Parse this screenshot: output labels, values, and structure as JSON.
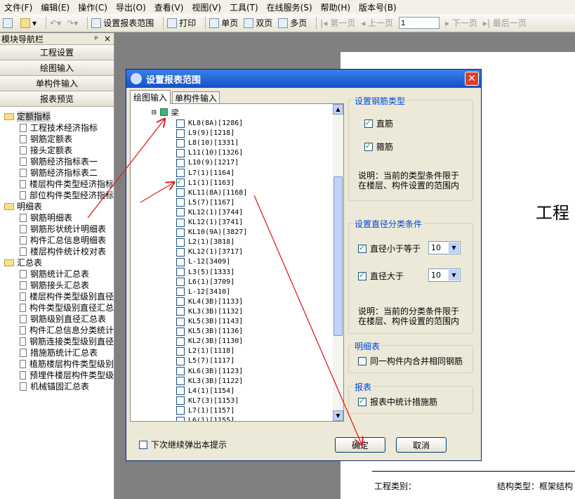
{
  "menu": [
    "文件(F)",
    "编辑(E)",
    "操作(C)",
    "导出(O)",
    "查看(V)",
    "视图(V)",
    "工具(T)",
    "在线服务(S)",
    "帮助(H)",
    "版本号(B)"
  ],
  "toolbar": {
    "set_range": "设置报表范围",
    "print": "打印",
    "single": "单页",
    "double": "双页",
    "multi": "多页",
    "first": "第一页",
    "prev": "上一页",
    "page_value": "1",
    "next": "下一页",
    "last": "最后一页"
  },
  "panel": {
    "title": "模块导航栏",
    "pin": "ᵖ",
    "close": "×",
    "nav": [
      "工程设置",
      "绘图输入",
      "单构件输入",
      "报表预览"
    ],
    "tree": [
      {
        "type": "folder",
        "label": "定额指标",
        "children": [
          "工程技术经济指标",
          "钢筋定额表",
          "接头定额表",
          "钢筋经济指标表一",
          "钢筋经济指标表二",
          "楼层构件类型经济指标",
          "部位构件类型经济指标"
        ]
      },
      {
        "type": "folder",
        "label": "明细表",
        "children": [
          "钢筋明细表",
          "钢筋形状统计明细表",
          "构件汇总信息明细表",
          "楼层构件统计校对表"
        ]
      },
      {
        "type": "folder",
        "label": "汇总表",
        "children": [
          "钢筋统计汇总表",
          "钢筋接头汇总表",
          "楼层构件类型级别直径",
          "构件类型级别直径汇总",
          "钢筋级别直径汇总表",
          "构件汇总信息分类统计",
          "钢筋连接类型级别直径",
          "措施筋统计汇总表",
          "植筋楼层构件类型级别",
          "预埋件楼层构件类型级",
          "机械锚固汇总表"
        ]
      }
    ]
  },
  "preview": {
    "title": "工程",
    "footer_left": "工程类别：",
    "footer_right": "结构类型：框架结构"
  },
  "dialog": {
    "title": "设置报表范围",
    "close": "✕",
    "tabs": [
      "绘图输入",
      "单构件输入"
    ],
    "tree_root": "梁",
    "expander": "⊟",
    "items": [
      {
        "label": "KL8(8A)[1286]",
        "checked": false
      },
      {
        "label": "L9(9)[1218]",
        "checked": false
      },
      {
        "label": "L8(10)[1331]",
        "checked": false
      },
      {
        "label": "L11(10)[1326]",
        "checked": false
      },
      {
        "label": "L10(9)[1217]",
        "checked": false
      },
      {
        "label": "L7(1)[1164]",
        "checked": false
      },
      {
        "label": "L1(1)[1163]",
        "checked": true
      },
      {
        "label": "KL11(8A)[1168]",
        "checked": false
      },
      {
        "label": "L5(7)[1167]",
        "checked": false
      },
      {
        "label": "KL12(1)[3744]",
        "checked": false
      },
      {
        "label": "KL12(1)[3741]",
        "checked": false
      },
      {
        "label": "KL10(9A)[3827]",
        "checked": false
      },
      {
        "label": "L2(1)[3818]",
        "checked": false
      },
      {
        "label": "KL12(1)[3717]",
        "checked": false
      },
      {
        "label": "L-12[3409]",
        "checked": false
      },
      {
        "label": "L3(5)[1333]",
        "checked": false
      },
      {
        "label": "L6(1)[3709]",
        "checked": false
      },
      {
        "label": "L-12[3410]",
        "checked": false
      },
      {
        "label": "KL4(3B)[1133]",
        "checked": false
      },
      {
        "label": "KL3(3B)[1132]",
        "checked": false
      },
      {
        "label": "KL5(3B)[1143]",
        "checked": false
      },
      {
        "label": "KL5(3B)[1136]",
        "checked": false
      },
      {
        "label": "KL2(3B)[1130]",
        "checked": false
      },
      {
        "label": "L2(1)[1118]",
        "checked": false
      },
      {
        "label": "L5(7)[1117]",
        "checked": false
      },
      {
        "label": "KL6(3B)[1123]",
        "checked": false
      },
      {
        "label": "KL3(3B)[1122]",
        "checked": false
      },
      {
        "label": "L4(1)[1154]",
        "checked": false
      },
      {
        "label": "KL7(3)[1153]",
        "checked": false
      },
      {
        "label": "L7(1)[1157]",
        "checked": false
      },
      {
        "label": "L6(1)[1155]",
        "checked": false
      }
    ],
    "rebar_type": {
      "title": "设置钢筋类型",
      "opt1": "直筋",
      "opt2": "箍筋",
      "note1": "说明：当前的类型条件限于",
      "note2": "在楼层、构件设置的范围内"
    },
    "diameter": {
      "title": "设置直径分类条件",
      "less_label": "直径小于等于",
      "less_value": "10",
      "greater_label": "直径大于",
      "greater_value": "10",
      "note1": "说明：当前的分类条件限于",
      "note2": "在楼层、构件设置的范围内"
    },
    "detail": {
      "title": "明细表",
      "opt": "同一构件内合并相同钢筋"
    },
    "report": {
      "title": "报表",
      "opt": "报表中统计措施筋"
    },
    "next_time": "下次继续弹出本提示",
    "ok": "确定",
    "cancel": "取消"
  },
  "colors": {
    "accent": "#1450c8",
    "arrow": "#e02020",
    "check": "#21a121"
  }
}
